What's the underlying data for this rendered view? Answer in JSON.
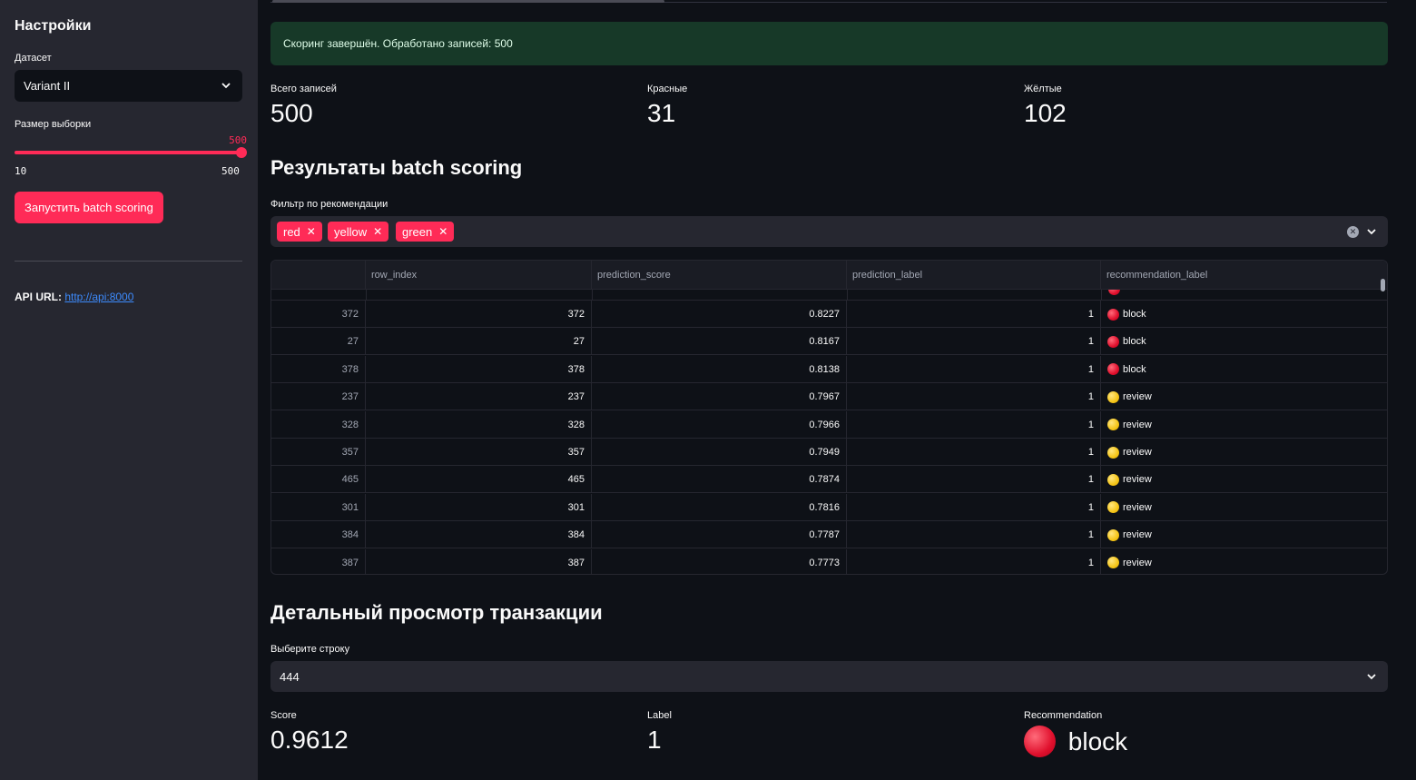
{
  "sidebar": {
    "title": "Настройки",
    "dataset_label": "Датасет",
    "dataset_value": "Variant II",
    "sample_label": "Размер выборки",
    "slider_value": "500",
    "slider_min": "10",
    "slider_max": "500",
    "run_button": "Запустить batch scoring",
    "api_label": "API URL:",
    "api_link": "http://api:8000"
  },
  "status": {
    "success_message": "Скоринг завершён. Обработано записей: 500"
  },
  "metrics": [
    {
      "label": "Всего записей",
      "value": "500"
    },
    {
      "label": "Красные",
      "value": "31"
    },
    {
      "label": "Жёлтые",
      "value": "102"
    }
  ],
  "results": {
    "heading": "Результаты batch scoring",
    "filter_label": "Фильтр по рекомендации",
    "filter_chips": [
      "red",
      "yellow",
      "green"
    ],
    "columns": [
      "row_index",
      "prediction_score",
      "prediction_label",
      "recommendation_label"
    ],
    "rows": [
      {
        "idx": "372",
        "row_index": "372",
        "score": "0.8227",
        "label": "1",
        "rec": "block",
        "color": "red"
      },
      {
        "idx": "27",
        "row_index": "27",
        "score": "0.8167",
        "label": "1",
        "rec": "block",
        "color": "red"
      },
      {
        "idx": "378",
        "row_index": "378",
        "score": "0.8138",
        "label": "1",
        "rec": "block",
        "color": "red"
      },
      {
        "idx": "237",
        "row_index": "237",
        "score": "0.7967",
        "label": "1",
        "rec": "review",
        "color": "yellow"
      },
      {
        "idx": "328",
        "row_index": "328",
        "score": "0.7966",
        "label": "1",
        "rec": "review",
        "color": "yellow"
      },
      {
        "idx": "357",
        "row_index": "357",
        "score": "0.7949",
        "label": "1",
        "rec": "review",
        "color": "yellow"
      },
      {
        "idx": "465",
        "row_index": "465",
        "score": "0.7874",
        "label": "1",
        "rec": "review",
        "color": "yellow"
      },
      {
        "idx": "301",
        "row_index": "301",
        "score": "0.7816",
        "label": "1",
        "rec": "review",
        "color": "yellow"
      },
      {
        "idx": "384",
        "row_index": "384",
        "score": "0.7787",
        "label": "1",
        "rec": "review",
        "color": "yellow"
      },
      {
        "idx": "387",
        "row_index": "387",
        "score": "0.7773",
        "label": "1",
        "rec": "review",
        "color": "yellow"
      }
    ]
  },
  "detail": {
    "heading": "Детальный просмотр транзакции",
    "select_label": "Выберите строку",
    "select_value": "444",
    "score_label": "Score",
    "score_value": "0.9612",
    "label_label": "Label",
    "label_value": "1",
    "rec_label": "Recommendation",
    "rec_value": "block"
  },
  "colors": {
    "accent": "#ff2b57",
    "success_bg": "#173928",
    "sidebar_bg": "#262730",
    "page_bg": "#0e1117"
  }
}
